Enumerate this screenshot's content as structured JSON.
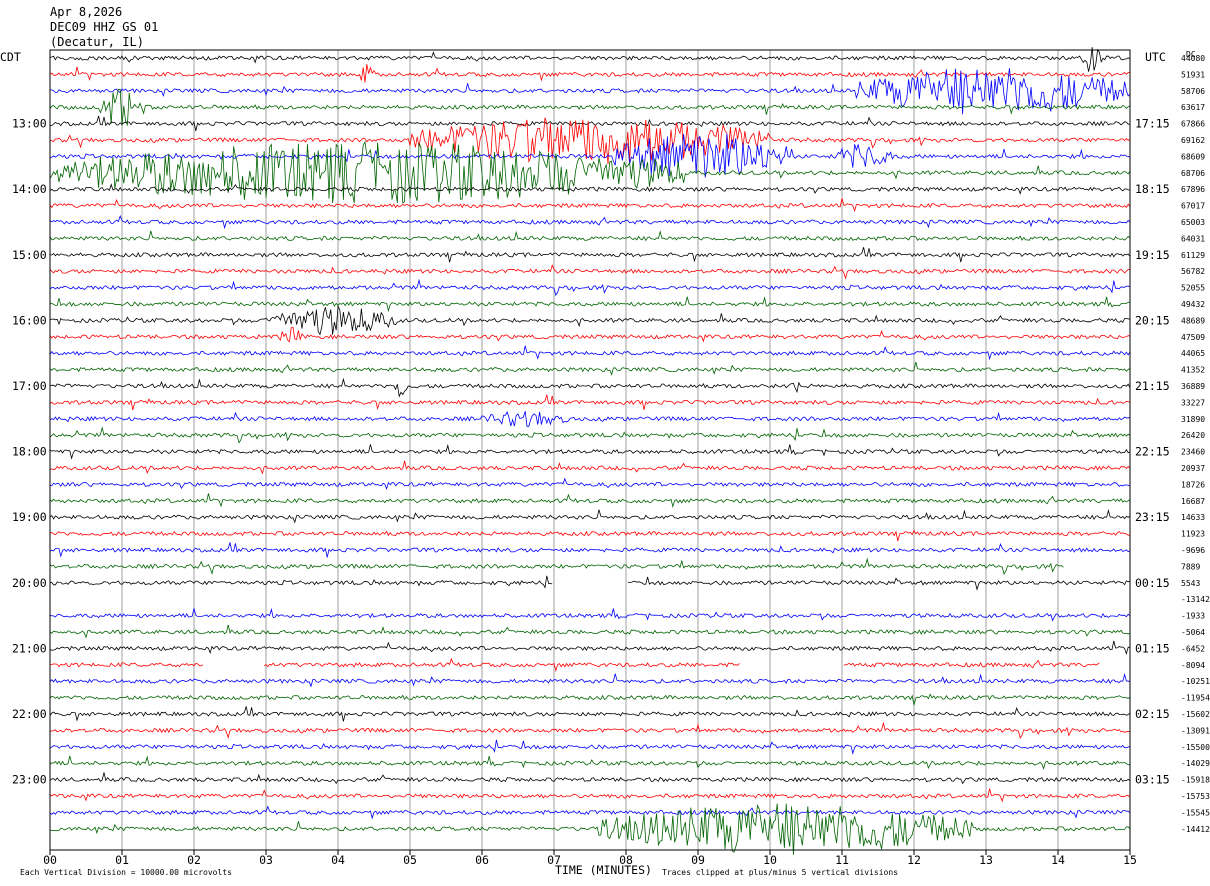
{
  "header": {
    "date": "Apr 8,2026",
    "station": "DEC09 HHZ GS 01",
    "location": "(Decatur, IL)",
    "left_tz": "CDT",
    "right_tz": "UTC",
    "corner_tag": "DC"
  },
  "footer": {
    "scale_note": "Each Vertical Division = 10000.00 microvolts",
    "axis_title": "TIME (MINUTES)",
    "clip_note": "Traces clipped at plus/minus 5 vertical divisions"
  },
  "colors": {
    "cycle": [
      "#000000",
      "#ff0000",
      "#0000ff",
      "#006400"
    ],
    "grid": "#888888",
    "frame": "#000000"
  },
  "chart_data": {
    "type": "line",
    "subtype": "helicorder",
    "xlabel": "TIME (MINUTES)",
    "xlim": [
      0,
      15
    ],
    "x_ticks": [
      "00",
      "01",
      "02",
      "03",
      "04",
      "05",
      "06",
      "07",
      "08",
      "09",
      "10",
      "11",
      "12",
      "13",
      "14",
      "15"
    ],
    "row_minutes": 15,
    "row_count": 48,
    "left_hour_labels": [
      "13:00",
      "14:00",
      "15:00",
      "16:00",
      "17:00",
      "18:00",
      "19:00",
      "20:00",
      "21:00",
      "22:00",
      "23:00"
    ],
    "right_hour_labels": [
      "17:15",
      "18:15",
      "19:15",
      "20:15",
      "21:15",
      "22:15",
      "23:15",
      "00:15",
      "01:15",
      "02:15",
      "03:15"
    ],
    "trace_offsets": [
      "44080",
      "51931",
      "58706",
      "63617",
      "67866",
      "69162",
      "68609",
      "68706",
      "67896",
      "67017",
      "65003",
      "64031",
      "61129",
      "56782",
      "52055",
      "49432",
      "48689",
      "47509",
      "44065",
      "41352",
      "36889",
      "33227",
      "31890",
      "26420",
      "23460",
      "20937",
      "18726",
      "16687",
      "14633",
      "11923",
      "-9696",
      "7889",
      "5543",
      "-13142",
      "-1933",
      "-5064",
      "-6452",
      "-8094",
      "-10251",
      "-11954",
      "-15602",
      "-13091",
      "-15500",
      "-14029",
      "-15918",
      "-15753",
      "-15545",
      "-14412"
    ],
    "events": [
      {
        "row": 0,
        "t": [
          14.35,
          14.6
        ],
        "amp": 1.2
      },
      {
        "row": 1,
        "t": [
          4.3,
          4.5
        ],
        "amp": 0.7
      },
      {
        "row": 2,
        "t": [
          11.2,
          15.0
        ],
        "amp": 1.5
      },
      {
        "row": 3,
        "t": [
          0.7,
          1.3
        ],
        "amp": 1.3
      },
      {
        "row": 5,
        "t": [
          5.0,
          10.0
        ],
        "amp": 1.5
      },
      {
        "row": 6,
        "t": [
          7.8,
          10.3
        ],
        "amp": 1.5
      },
      {
        "row": 6,
        "t": [
          10.9,
          11.7
        ],
        "amp": 0.8
      },
      {
        "row": 7,
        "t": [
          0.0,
          8.8
        ],
        "amp": 1.9
      },
      {
        "row": 16,
        "t": [
          3.0,
          4.8
        ],
        "amp": 0.9
      },
      {
        "row": 17,
        "t": [
          3.2,
          3.5
        ],
        "amp": 0.6
      },
      {
        "row": 20,
        "t": [
          4.8,
          4.95
        ],
        "amp": 0.9
      },
      {
        "row": 20,
        "t": [
          10.25,
          10.4
        ],
        "amp": 0.7
      },
      {
        "row": 22,
        "t": [
          6.0,
          7.2
        ],
        "amp": 0.5
      },
      {
        "row": 47,
        "t": [
          7.6,
          12.8
        ],
        "amp": 1.6
      }
    ],
    "gaps": [
      {
        "row": 32,
        "t": [
          7.0,
          8.0
        ]
      },
      {
        "row": 33,
        "t": [
          0.0,
          15.0
        ]
      },
      {
        "row": 37,
        "t": [
          2.15,
          2.95
        ]
      },
      {
        "row": 37,
        "t": [
          9.6,
          11.0
        ]
      },
      {
        "row": 37,
        "t": [
          14.6,
          15.0
        ]
      },
      {
        "row": 31,
        "t": [
          14.1,
          15.0
        ]
      }
    ]
  }
}
